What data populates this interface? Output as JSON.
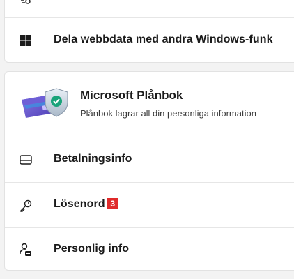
{
  "top_section": {
    "items": [
      {
        "label": "",
        "icon": "settings-icon"
      },
      {
        "label": "Dela webbdata med andra Windows-funk",
        "icon": "windows-logo-icon"
      }
    ]
  },
  "wallet_section": {
    "title": "Microsoft Plånbok",
    "subtitle": "Plånbok lagrar all din personliga information",
    "image": "wallet-shield-illustration",
    "items": [
      {
        "label": "Betalningsinfo",
        "icon": "credit-card-icon"
      },
      {
        "label": "Lösenord",
        "icon": "key-icon",
        "badge": "3",
        "badge_color": "#e02a2a"
      },
      {
        "label": "Personlig info",
        "icon": "person-id-icon"
      }
    ]
  }
}
